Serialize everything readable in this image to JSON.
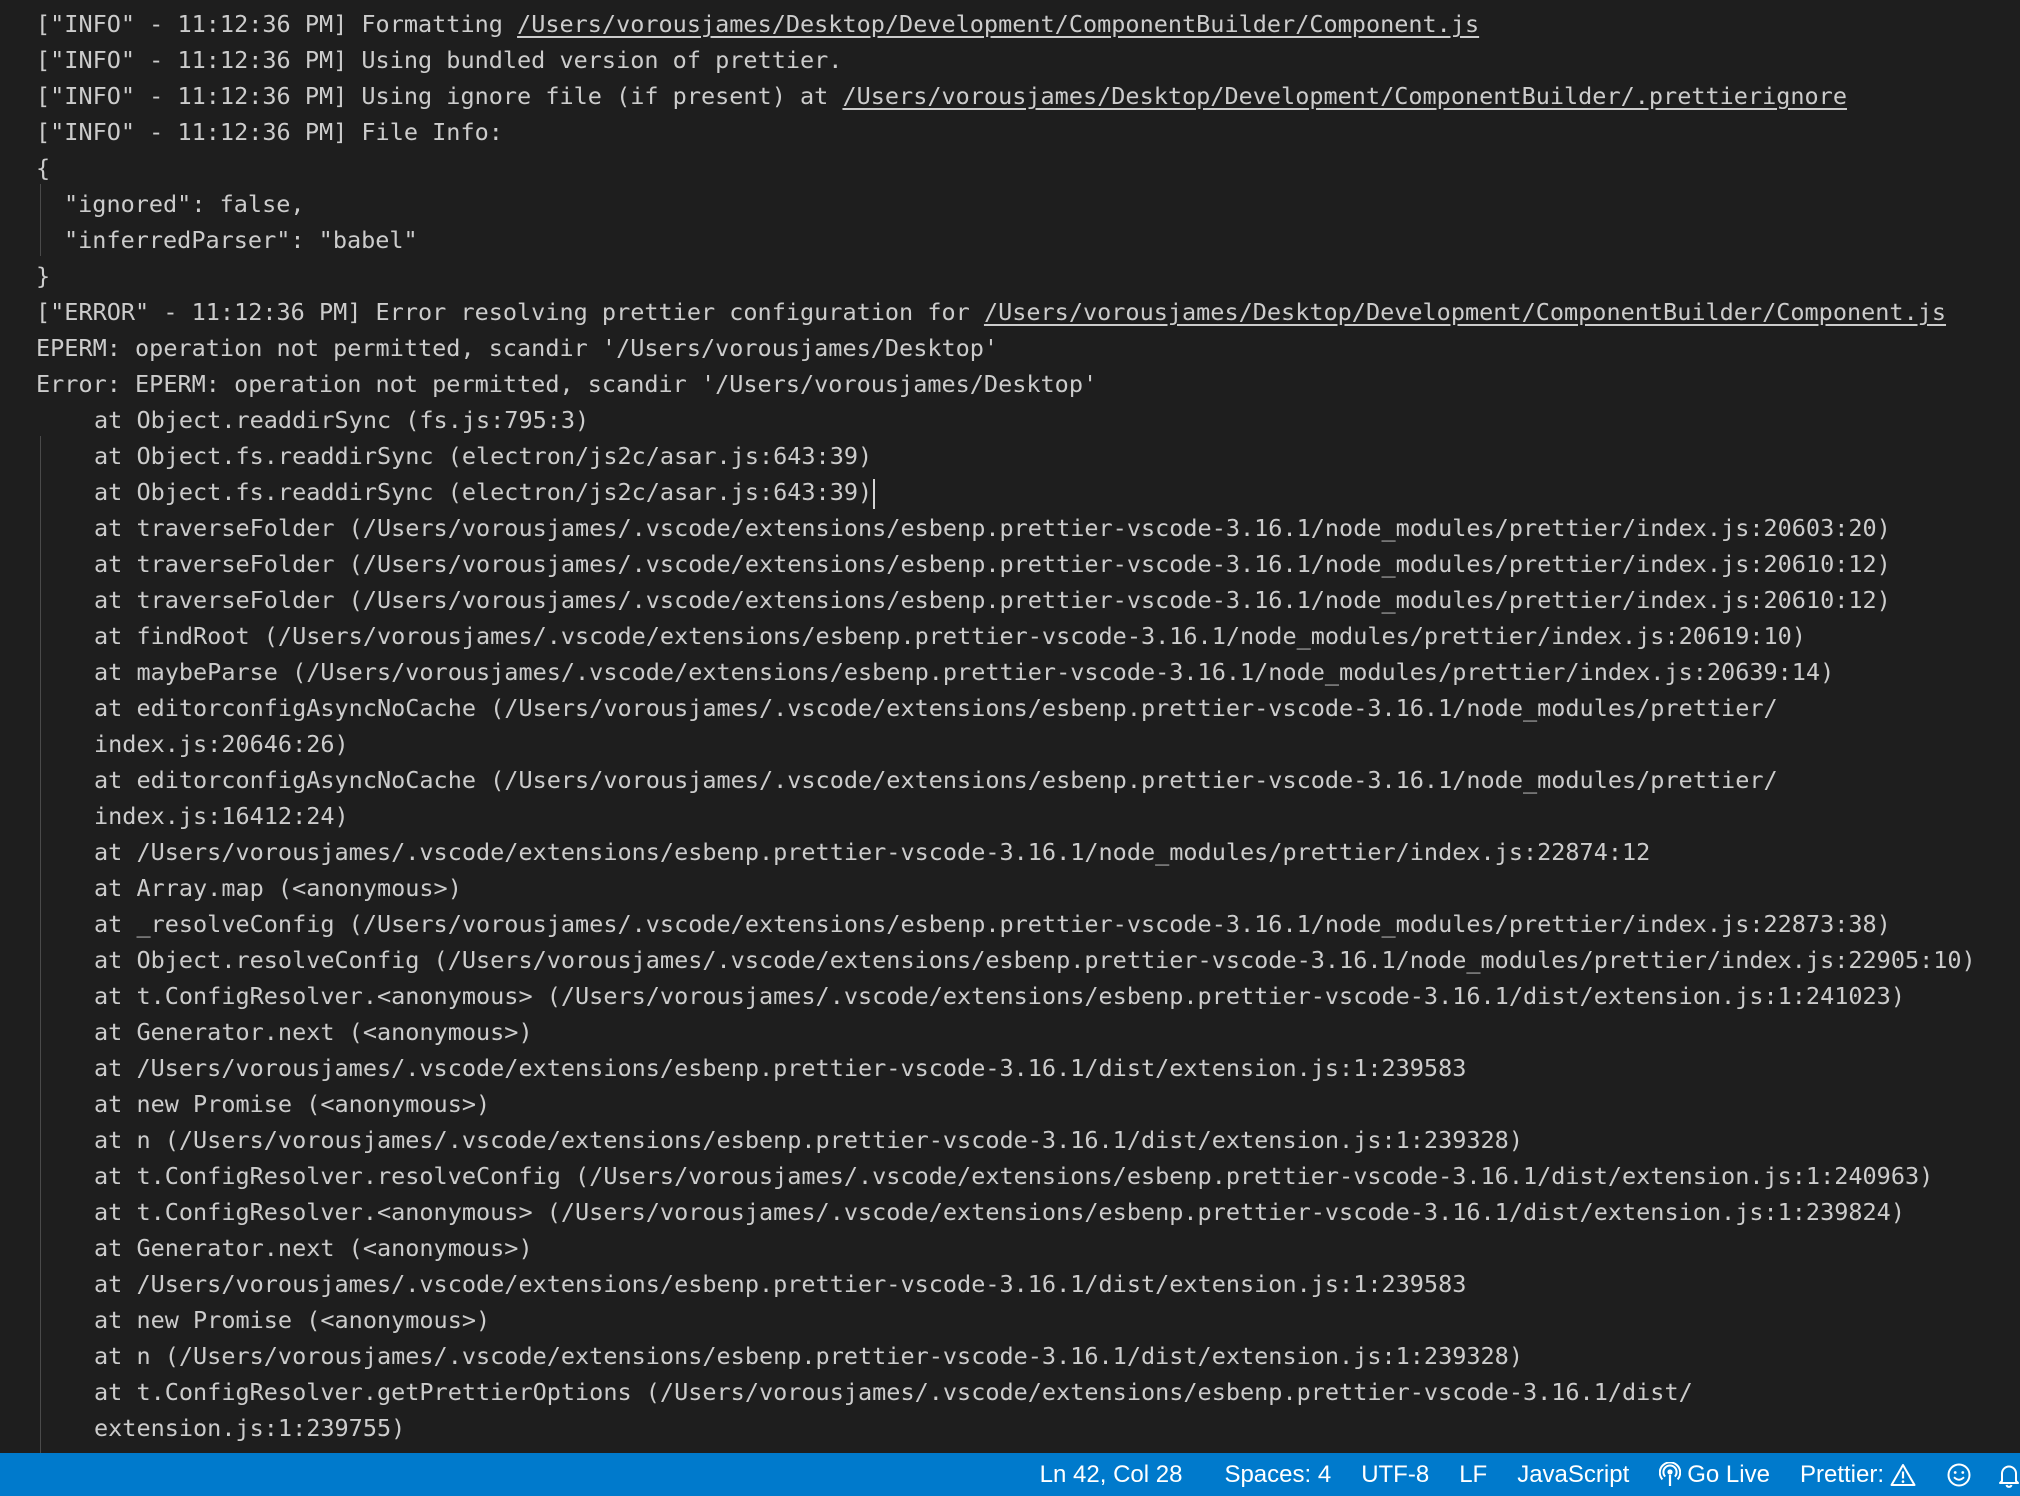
{
  "output": {
    "lines": [
      {
        "indent": 0,
        "parts": [
          {
            "text": "[\"INFO\" - 11:12:36 PM] Formatting "
          },
          {
            "text": "/Users/vorousjames/Desktop/Development/ComponentBuilder/Component.js",
            "link": true
          }
        ]
      },
      {
        "indent": 0,
        "parts": [
          {
            "text": "[\"INFO\" - 11:12:36 PM] Using bundled version of prettier."
          }
        ]
      },
      {
        "indent": 0,
        "parts": [
          {
            "text": "[\"INFO\" - 11:12:36 PM] Using ignore file (if present) at "
          },
          {
            "text": "/Users/vorousjames/Desktop/Development/ComponentBuilder/.prettierignore",
            "link": true
          }
        ]
      },
      {
        "indent": 0,
        "parts": [
          {
            "text": "[\"INFO\" - 11:12:36 PM] File Info:"
          }
        ]
      },
      {
        "indent": 0,
        "parts": [
          {
            "text": "{"
          }
        ]
      },
      {
        "indent": 1,
        "parts": [
          {
            "text": "\"ignored\": false,"
          }
        ]
      },
      {
        "indent": 1,
        "parts": [
          {
            "text": "\"inferredParser\": \"babel\""
          }
        ]
      },
      {
        "indent": 0,
        "parts": [
          {
            "text": "}"
          }
        ]
      },
      {
        "indent": 0,
        "parts": [
          {
            "text": "[\"ERROR\" - 11:12:36 PM] Error resolving prettier configuration for "
          },
          {
            "text": "/Users/vorousjames/Desktop/Development/ComponentBuilder/Component.js",
            "link": true
          }
        ]
      },
      {
        "indent": 0,
        "parts": [
          {
            "text": "EPERM: operation not permitted, scandir '/Users/vorousjames/Desktop'"
          }
        ]
      },
      {
        "indent": 0,
        "parts": [
          {
            "text": "Error: EPERM: operation not permitted, scandir '/Users/vorousjames/Desktop'"
          }
        ]
      },
      {
        "indent": 2,
        "parts": [
          {
            "text": "at Object.readdirSync (fs.js:795:3)"
          }
        ]
      },
      {
        "indent": 2,
        "parts": [
          {
            "text": "at Object.fs.readdirSync (electron/js2c/asar.js:643:39)"
          }
        ]
      },
      {
        "indent": 2,
        "caret": true,
        "parts": [
          {
            "text": "at Object.fs.readdirSync (electron/js2c/asar.js:643:39)"
          }
        ]
      },
      {
        "indent": 2,
        "parts": [
          {
            "text": "at traverseFolder (/Users/vorousjames/.vscode/extensions/esbenp.prettier-vscode-3.16.1/node_modules/prettier/index.js:20603:20)"
          }
        ]
      },
      {
        "indent": 2,
        "parts": [
          {
            "text": "at traverseFolder (/Users/vorousjames/.vscode/extensions/esbenp.prettier-vscode-3.16.1/node_modules/prettier/index.js:20610:12)"
          }
        ]
      },
      {
        "indent": 2,
        "parts": [
          {
            "text": "at traverseFolder (/Users/vorousjames/.vscode/extensions/esbenp.prettier-vscode-3.16.1/node_modules/prettier/index.js:20610:12)"
          }
        ]
      },
      {
        "indent": 2,
        "parts": [
          {
            "text": "at findRoot (/Users/vorousjames/.vscode/extensions/esbenp.prettier-vscode-3.16.1/node_modules/prettier/index.js:20619:10)"
          }
        ]
      },
      {
        "indent": 2,
        "parts": [
          {
            "text": "at maybeParse (/Users/vorousjames/.vscode/extensions/esbenp.prettier-vscode-3.16.1/node_modules/prettier/index.js:20639:14)"
          }
        ]
      },
      {
        "indent": 2,
        "parts": [
          {
            "text": "at editorconfigAsyncNoCache (/Users/vorousjames/.vscode/extensions/esbenp.prettier-vscode-3.16.1/node_modules/prettier/"
          }
        ]
      },
      {
        "indent": 2,
        "parts": [
          {
            "text": "index.js:20646:26)"
          }
        ]
      },
      {
        "indent": 2,
        "parts": [
          {
            "text": "at editorconfigAsyncNoCache (/Users/vorousjames/.vscode/extensions/esbenp.prettier-vscode-3.16.1/node_modules/prettier/"
          }
        ]
      },
      {
        "indent": 2,
        "parts": [
          {
            "text": "index.js:16412:24)"
          }
        ]
      },
      {
        "indent": 2,
        "parts": [
          {
            "text": "at /Users/vorousjames/.vscode/extensions/esbenp.prettier-vscode-3.16.1/node_modules/prettier/index.js:22874:12"
          }
        ]
      },
      {
        "indent": 2,
        "parts": [
          {
            "text": "at Array.map (<anonymous>)"
          }
        ]
      },
      {
        "indent": 2,
        "parts": [
          {
            "text": "at _resolveConfig (/Users/vorousjames/.vscode/extensions/esbenp.prettier-vscode-3.16.1/node_modules/prettier/index.js:22873:38)"
          }
        ]
      },
      {
        "indent": 2,
        "parts": [
          {
            "text": "at Object.resolveConfig (/Users/vorousjames/.vscode/extensions/esbenp.prettier-vscode-3.16.1/node_modules/prettier/index.js:22905:10)"
          }
        ]
      },
      {
        "indent": 2,
        "parts": [
          {
            "text": "at t.ConfigResolver.<anonymous> (/Users/vorousjames/.vscode/extensions/esbenp.prettier-vscode-3.16.1/dist/extension.js:1:241023)"
          }
        ]
      },
      {
        "indent": 2,
        "parts": [
          {
            "text": "at Generator.next (<anonymous>)"
          }
        ]
      },
      {
        "indent": 2,
        "parts": [
          {
            "text": "at /Users/vorousjames/.vscode/extensions/esbenp.prettier-vscode-3.16.1/dist/extension.js:1:239583"
          }
        ]
      },
      {
        "indent": 2,
        "parts": [
          {
            "text": "at new Promise (<anonymous>)"
          }
        ]
      },
      {
        "indent": 2,
        "parts": [
          {
            "text": "at n (/Users/vorousjames/.vscode/extensions/esbenp.prettier-vscode-3.16.1/dist/extension.js:1:239328)"
          }
        ]
      },
      {
        "indent": 2,
        "parts": [
          {
            "text": "at t.ConfigResolver.resolveConfig (/Users/vorousjames/.vscode/extensions/esbenp.prettier-vscode-3.16.1/dist/extension.js:1:240963)"
          }
        ]
      },
      {
        "indent": 2,
        "parts": [
          {
            "text": "at t.ConfigResolver.<anonymous> (/Users/vorousjames/.vscode/extensions/esbenp.prettier-vscode-3.16.1/dist/extension.js:1:239824)"
          }
        ]
      },
      {
        "indent": 2,
        "parts": [
          {
            "text": "at Generator.next (<anonymous>)"
          }
        ]
      },
      {
        "indent": 2,
        "parts": [
          {
            "text": "at /Users/vorousjames/.vscode/extensions/esbenp.prettier-vscode-3.16.1/dist/extension.js:1:239583"
          }
        ]
      },
      {
        "indent": 2,
        "parts": [
          {
            "text": "at new Promise (<anonymous>)"
          }
        ]
      },
      {
        "indent": 2,
        "parts": [
          {
            "text": "at n (/Users/vorousjames/.vscode/extensions/esbenp.prettier-vscode-3.16.1/dist/extension.js:1:239328)"
          }
        ]
      },
      {
        "indent": 2,
        "parts": [
          {
            "text": "at t.ConfigResolver.getPrettierOptions (/Users/vorousjames/.vscode/extensions/esbenp.prettier-vscode-3.16.1/dist/"
          }
        ]
      },
      {
        "indent": 2,
        "parts": [
          {
            "text": "extension.js:1:239755)"
          }
        ]
      }
    ]
  },
  "status_bar": {
    "cursor_position": "Ln 42, Col 28",
    "indentation": "Spaces: 4",
    "encoding": "UTF-8",
    "line_ending": "LF",
    "language": "JavaScript",
    "go_live_label": "Go Live",
    "go_live_icon": "broadcast-icon",
    "prettier_label": "Prettier:",
    "prettier_icon": "warning-icon",
    "feedback_icon": "smiley-icon",
    "notifications_icon": "bell-icon",
    "background_color": "#007acc"
  }
}
